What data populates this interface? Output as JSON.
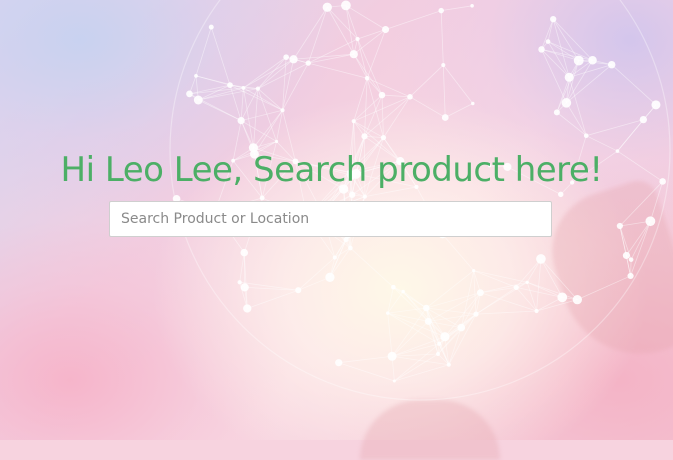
{
  "hero": {
    "title": "Hi Leo Lee, Search product here!",
    "title_color": "#4caf66"
  },
  "search": {
    "placeholder": "Search Product or Location",
    "value": ""
  },
  "background": {
    "description_colors": [
      "#d6d8f1",
      "#f2cde0",
      "#fff6e8",
      "#f3c6d6"
    ]
  }
}
